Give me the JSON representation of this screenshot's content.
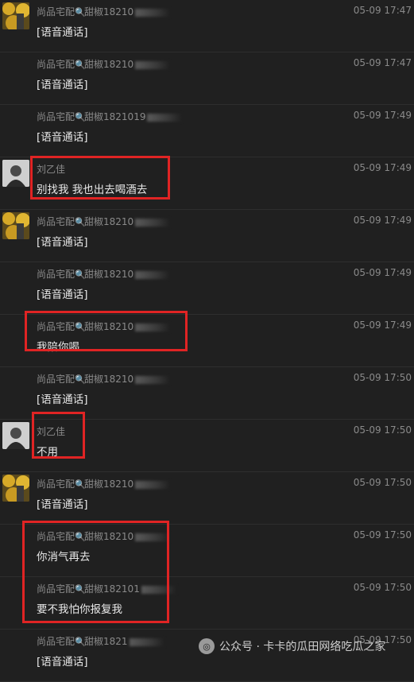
{
  "messages": [
    {
      "sender": "尚品宅配",
      "tail": "甜椒18210",
      "time": "05-09 17:47",
      "text": "[语音通话]",
      "avatar": "a"
    },
    {
      "sender": "尚品宅配",
      "tail": "甜椒18210",
      "time": "05-09 17:47",
      "text": "[语音通话]",
      "avatar": ""
    },
    {
      "sender": "尚品宅配",
      "tail": "甜椒1821019",
      "time": "05-09 17:49",
      "text": "[语音通话]",
      "avatar": ""
    },
    {
      "sender": "刘乙佳",
      "tail": "",
      "time": "05-09 17:49",
      "text": "别找我 我也出去喝酒去",
      "avatar": "b"
    },
    {
      "sender": "尚品宅配",
      "tail": "甜椒18210",
      "time": "05-09 17:49",
      "text": "[语音通话]",
      "avatar": "a"
    },
    {
      "sender": "尚品宅配",
      "tail": "甜椒18210",
      "time": "05-09 17:49",
      "text": "[语音通话]",
      "avatar": ""
    },
    {
      "sender": "尚品宅配",
      "tail": "甜椒18210",
      "time": "05-09 17:49",
      "text": "我陪你喝",
      "avatar": ""
    },
    {
      "sender": "尚品宅配",
      "tail": "甜椒18210",
      "time": "05-09 17:50",
      "text": "[语音通话]",
      "avatar": ""
    },
    {
      "sender": "刘乙佳",
      "tail": "",
      "time": "05-09 17:50",
      "text": "不用",
      "avatar": "b"
    },
    {
      "sender": "尚品宅配",
      "tail": "甜椒18210",
      "time": "05-09 17:50",
      "text": "[语音通话]",
      "avatar": "a"
    },
    {
      "sender": "尚品宅配",
      "tail": "甜椒18210",
      "time": "05-09 17:50",
      "text": "你消气再去",
      "avatar": ""
    },
    {
      "sender": "尚品宅配",
      "tail": "甜椒182101",
      "time": "05-09 17:50",
      "text": "要不我怕你报复我",
      "avatar": ""
    },
    {
      "sender": "尚品宅配",
      "tail": "甜椒1821",
      "time": "05-09 17:50",
      "text": "[语音通话]",
      "avatar": ""
    }
  ],
  "magnifier_icon": "🔍",
  "watermark": {
    "text": "公众号 · 卡卡的瓜田网络吃瓜之家",
    "icon": "wechat-icon"
  },
  "colors": {
    "highlight": "#e02424",
    "background": "#202020"
  }
}
